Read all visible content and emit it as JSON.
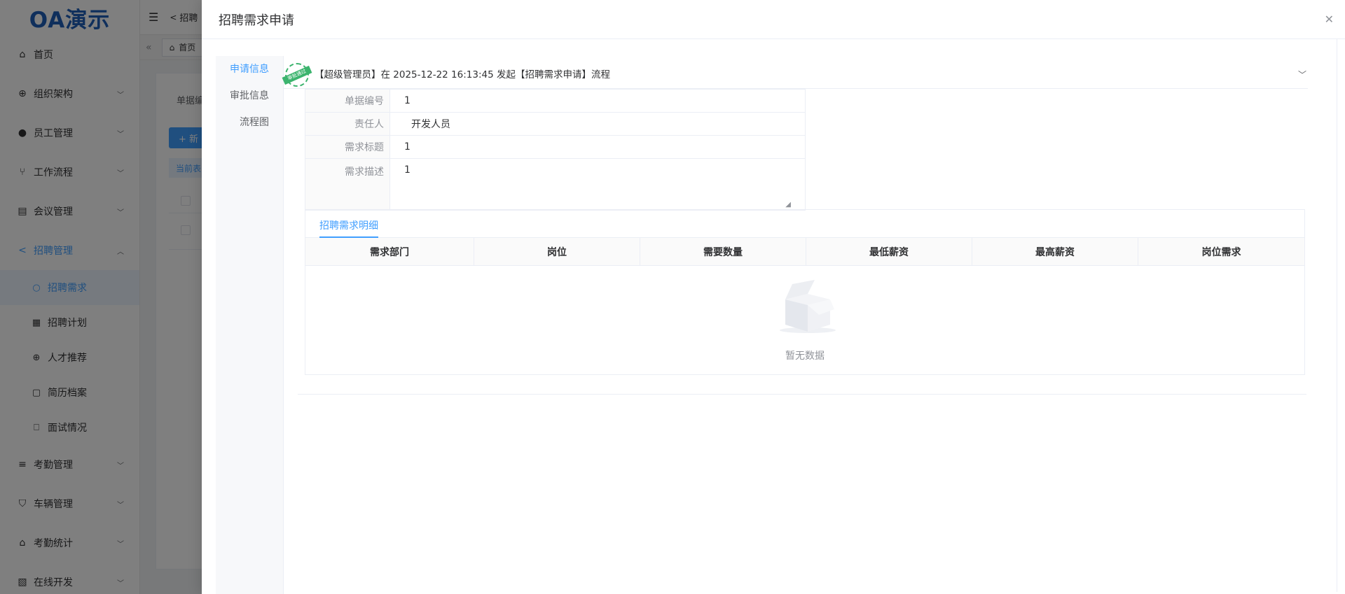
{
  "app": {
    "logo": "OA演示"
  },
  "sidebar": {
    "items": [
      {
        "label": "首页",
        "icon": "home-icon"
      },
      {
        "label": "组织架构",
        "icon": "org-icon"
      },
      {
        "label": "员工管理",
        "icon": "user-icon"
      },
      {
        "label": "工作流程",
        "icon": "flow-icon"
      },
      {
        "label": "会议管理",
        "icon": "meeting-icon"
      },
      {
        "label": "招聘管理",
        "icon": "share-icon"
      },
      {
        "label": "考勤管理",
        "icon": "list-icon"
      },
      {
        "label": "车辆管理",
        "icon": "cart-icon"
      },
      {
        "label": "考勤统计",
        "icon": "house-icon"
      },
      {
        "label": "在线开发",
        "icon": "dev-icon"
      }
    ],
    "sub_items": [
      {
        "label": "招聘需求",
        "icon": "cloud-icon"
      },
      {
        "label": "招聘计划",
        "icon": "calendar-icon"
      },
      {
        "label": "人才推荐",
        "icon": "plus-circle-icon"
      },
      {
        "label": "简历档案",
        "icon": "doc-icon"
      },
      {
        "label": "面试情况",
        "icon": "bookmark-icon"
      }
    ]
  },
  "topbar": {
    "breadcrumb": "招聘"
  },
  "tabsbar": {
    "home_tab": "首页"
  },
  "background": {
    "label": "单据编",
    "button": "+ 新",
    "alert": "当前表"
  },
  "drawer": {
    "title": "招聘需求申请",
    "nav": [
      "申请信息",
      "审批信息",
      "流程图"
    ],
    "info": "【超级管理员】在 2025-12-22 16:13:45 发起【招聘需求申请】流程",
    "stamp_text": "审批通过",
    "form": {
      "rows": [
        {
          "label": "单据编号",
          "value": "1"
        },
        {
          "label": "责任人",
          "value": "开发人员"
        },
        {
          "label": "需求标题",
          "value": "1"
        },
        {
          "label": "需求描述",
          "value": "1"
        }
      ]
    },
    "detail": {
      "tab": "招聘需求明细",
      "columns": [
        "需求部门",
        "岗位",
        "需要数量",
        "最低薪资",
        "最高薪资",
        "岗位需求"
      ],
      "empty_text": "暂无数据"
    }
  },
  "colors": {
    "primary": "#409eff",
    "logo": "#1f5fb8",
    "stamp": "#3cb46e"
  }
}
